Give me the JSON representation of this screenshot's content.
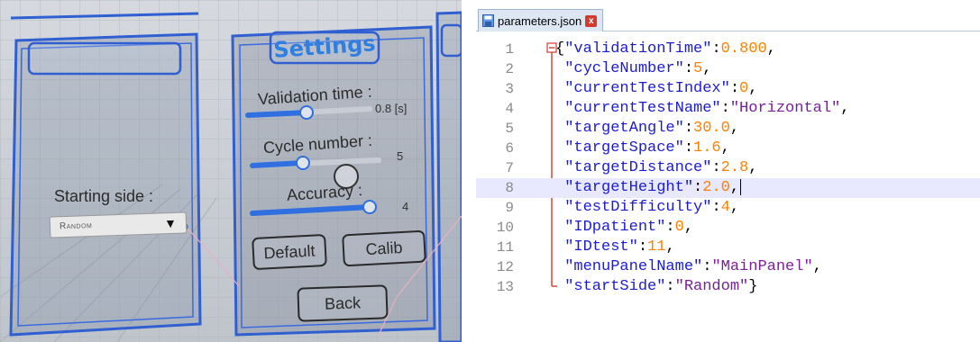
{
  "vr": {
    "settings_title": "Settings",
    "validation_time": {
      "label": "Validation time :",
      "value": "0.8 [s]",
      "level": 0.35
    },
    "cycle_number": {
      "label": "Cycle number :",
      "value": "5",
      "level": 0.3
    },
    "accuracy": {
      "label": "Accuracy :",
      "value": "4",
      "level": 1.0
    },
    "starting_side": {
      "label": "Starting side :",
      "selected": "Random"
    },
    "buttons": {
      "default": "Default",
      "calib": "Calib",
      "back": "Back"
    }
  },
  "editor": {
    "tab_name": "parameters.json",
    "tab_close": "x",
    "current_line": 8,
    "lines": [
      {
        "num": "1",
        "key": "validationTime",
        "value": "0.800",
        "type": "num",
        "open": true
      },
      {
        "num": "2",
        "key": "cycleNumber",
        "value": "5",
        "type": "num"
      },
      {
        "num": "3",
        "key": "currentTestIndex",
        "value": "0",
        "type": "num"
      },
      {
        "num": "4",
        "key": "currentTestName",
        "value": "\"Horizontal\"",
        "type": "str"
      },
      {
        "num": "5",
        "key": "targetAngle",
        "value": "30.0",
        "type": "num"
      },
      {
        "num": "6",
        "key": "targetSpace",
        "value": "1.6",
        "type": "num"
      },
      {
        "num": "7",
        "key": "targetDistance",
        "value": "2.8",
        "type": "num"
      },
      {
        "num": "8",
        "key": "targetHeight",
        "value": "2.0",
        "type": "num"
      },
      {
        "num": "9",
        "key": "testDifficulty",
        "value": "4",
        "type": "num"
      },
      {
        "num": "10",
        "key": "IDpatient",
        "value": "0",
        "type": "num"
      },
      {
        "num": "11",
        "key": "IDtest",
        "value": "11",
        "type": "num"
      },
      {
        "num": "12",
        "key": "menuPanelName",
        "value": "\"MainPanel\"",
        "type": "str"
      },
      {
        "num": "13",
        "key": "startSide",
        "value": "\"Random\"",
        "type": "str",
        "close": true
      }
    ]
  }
}
